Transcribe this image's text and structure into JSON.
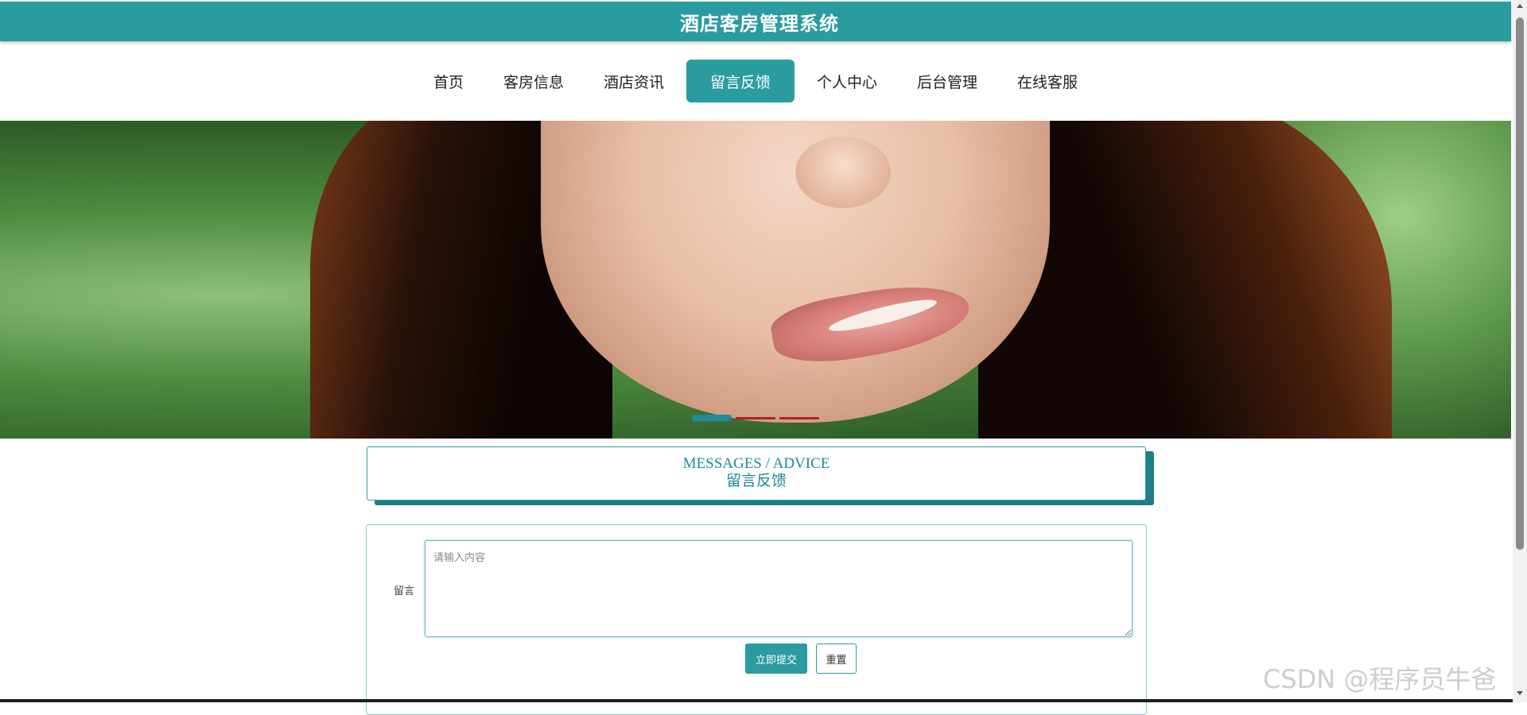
{
  "header": {
    "title": "酒店客房管理系统"
  },
  "nav": {
    "items": [
      {
        "label": "首页"
      },
      {
        "label": "客房信息"
      },
      {
        "label": "酒店资讯"
      },
      {
        "label": "留言反馈"
      },
      {
        "label": "个人中心"
      },
      {
        "label": "后台管理"
      },
      {
        "label": "在线客服"
      }
    ],
    "active": "留言反馈"
  },
  "banner": {
    "slide_count": 3,
    "active_slide": 1
  },
  "section": {
    "title_en": "MESSAGES / ADVICE",
    "title_cn": "留言反馈"
  },
  "form": {
    "message_label": "留言",
    "message_placeholder": "请输入内容",
    "message_value": "",
    "submit_label": "立即提交",
    "reset_label": "重置"
  },
  "watermark": "CSDN @程序员牛爸",
  "colors": {
    "accent": "#2a9ca0",
    "accent_dark": "#1f7f86",
    "dot_inactive": "#b52020"
  }
}
